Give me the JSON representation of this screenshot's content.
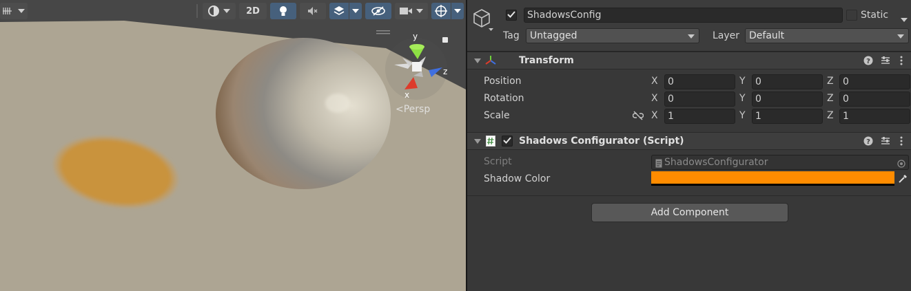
{
  "scene": {
    "toolbar": {
      "btn_2d_label": "2D",
      "icons": [
        "grid-snap-icon",
        "shading-mode-icon",
        "lighting-icon",
        "audio-icon",
        "effects-icon",
        "visibility-icon",
        "camera-icon",
        "gizmos-icon"
      ]
    },
    "gizmo": {
      "projection_label": "Persp",
      "axis_x": "x",
      "axis_y": "y",
      "axis_z": "z"
    },
    "colors": {
      "ground": "#ada593",
      "sky": "#474747",
      "shadow": "#c9933e",
      "accent_active": "#46607c"
    }
  },
  "inspector": {
    "object_name": "ShadowsConfig",
    "static_label": "Static",
    "tag_label": "Tag",
    "tag_value": "Untagged",
    "layer_label": "Layer",
    "layer_value": "Default",
    "transform": {
      "title": "Transform",
      "rows": [
        {
          "label": "Position",
          "x": "0",
          "y": "0",
          "z": "0"
        },
        {
          "label": "Rotation",
          "x": "0",
          "y": "0",
          "z": "0"
        },
        {
          "label": "Scale",
          "x": "1",
          "y": "1",
          "z": "1"
        }
      ],
      "axis_labels": [
        "X",
        "Y",
        "Z"
      ]
    },
    "script_component": {
      "title": "Shadows Configurator (Script)",
      "script_label": "Script",
      "script_value": "ShadowsConfigurator",
      "shadow_color_label": "Shadow Color",
      "shadow_color_value": "#ff8c00"
    },
    "add_component_label": "Add Component"
  }
}
